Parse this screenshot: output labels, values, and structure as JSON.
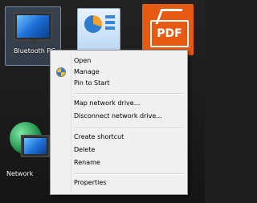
{
  "desktop": {
    "icons": [
      {
        "label": "Bluetooth PC"
      },
      {
        "label": ""
      },
      {
        "label": "PDF"
      },
      {
        "label": "Network"
      }
    ]
  },
  "context_menu": {
    "items": [
      {
        "label": "Open"
      },
      {
        "label": "Manage",
        "icon": "manage-shield-icon"
      },
      {
        "label": "Pin to Start"
      },
      {
        "label": "Map network drive..."
      },
      {
        "label": "Disconnect network drive..."
      },
      {
        "label": "Create shortcut"
      },
      {
        "label": "Delete"
      },
      {
        "label": "Rename"
      },
      {
        "label": "Properties"
      }
    ]
  },
  "colors": {
    "menu_background": "#f0f0f0",
    "menu_border": "#979797",
    "pdf_orange": "#e65a14"
  }
}
